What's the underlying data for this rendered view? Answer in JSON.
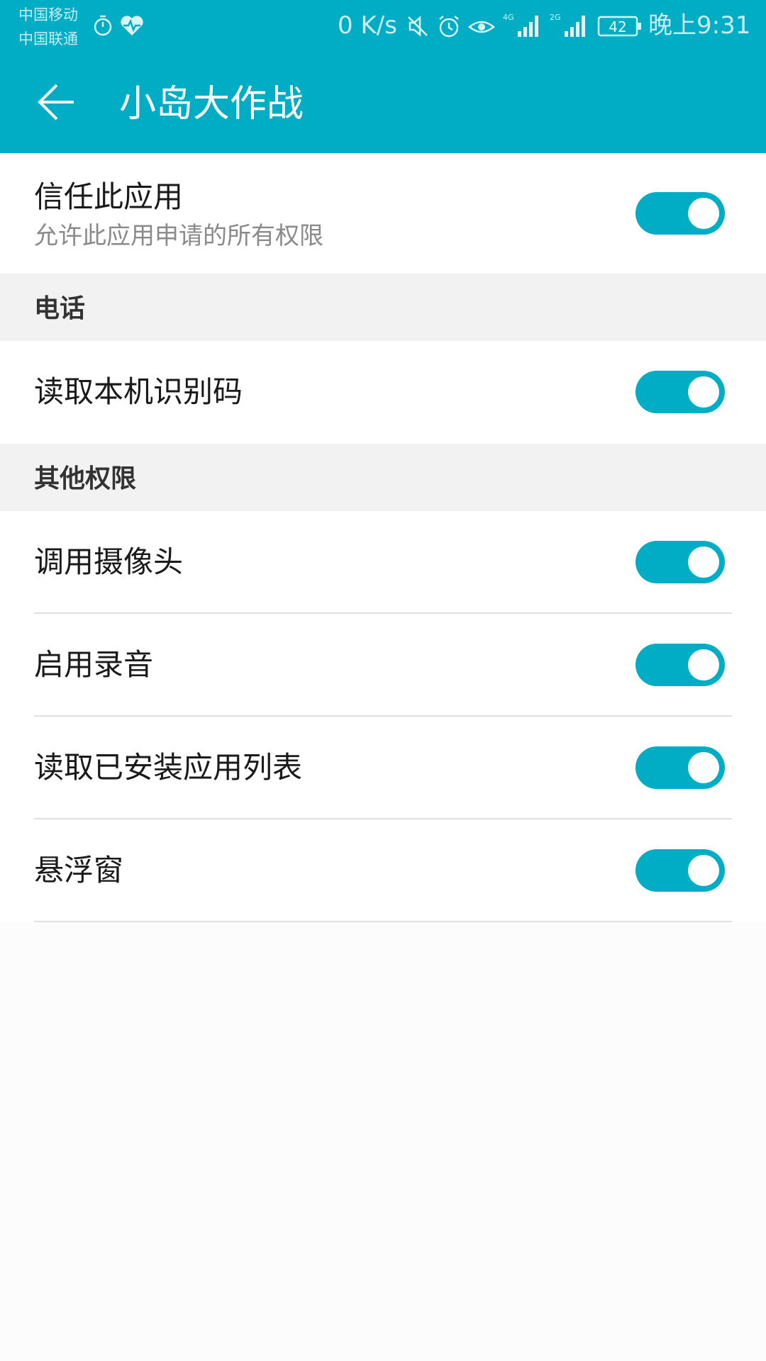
{
  "status_bar": {
    "carrier_1": "中国移动",
    "carrier_2": "中国联通",
    "net_speed": "0 K/s",
    "signal_1_label": "4G",
    "signal_2_label": "2G",
    "battery": "42",
    "time": "晚上9:31",
    "icons": [
      "stopwatch-icon",
      "heart-rate-icon",
      "mute-icon",
      "alarm-icon",
      "eye-icon",
      "signal-4g-icon",
      "signal-2g-icon",
      "battery-icon"
    ]
  },
  "app_bar": {
    "title": "小岛大作战",
    "back_icon": "arrow-left-icon"
  },
  "trust": {
    "label": "信任此应用",
    "sublabel": "允许此应用申请的所有权限",
    "enabled": true
  },
  "sections": [
    {
      "title": "电话",
      "items": [
        {
          "label": "读取本机识别码",
          "enabled": true
        }
      ]
    },
    {
      "title": "其他权限",
      "items": [
        {
          "label": "调用摄像头",
          "enabled": true
        },
        {
          "label": "启用录音",
          "enabled": true
        },
        {
          "label": "读取已安装应用列表",
          "enabled": true
        },
        {
          "label": "悬浮窗",
          "enabled": true
        }
      ]
    }
  ],
  "colors": {
    "accent": "#00adc4",
    "section_bg": "#f2f2f2",
    "row_bg": "#ffffff",
    "divider": "#e0e0e0"
  }
}
